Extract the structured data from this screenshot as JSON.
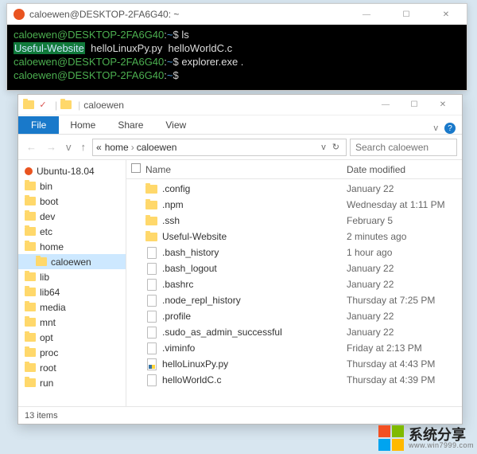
{
  "terminal": {
    "title": "caloewen@DESKTOP-2FA6G40: ~",
    "min": "—",
    "max": "☐",
    "close": "✕",
    "prompt_user": "caloewen@DESKTOP-2FA6G40",
    "prompt_sep": ":",
    "prompt_path": "~",
    "prompt_end": "$",
    "cmd1": "ls",
    "ls_highlight": "Useful-Website",
    "ls_item2": "helloLinuxPy.py",
    "ls_item3": "helloWorldC.c",
    "cmd2": "explorer.exe .",
    "cmd3": ""
  },
  "explorer": {
    "title": "caloewen",
    "min": "—",
    "max": "☐",
    "close": "✕",
    "tabs": {
      "file": "File",
      "home": "Home",
      "share": "Share",
      "view": "View"
    },
    "up_chev": "v",
    "help": "?",
    "nav": {
      "back": "←",
      "fwd": "→",
      "drop": "v",
      "up": "↑"
    },
    "addr": {
      "prefix": "«",
      "seg1": "home",
      "seg2": "caloewen",
      "go": "v",
      "refresh": "↻"
    },
    "search_placeholder": "Search caloewen",
    "cols": {
      "name": "Name",
      "date": "Date modified"
    },
    "tree_root": "Ubuntu-18.04",
    "tree": [
      {
        "label": "bin"
      },
      {
        "label": "boot"
      },
      {
        "label": "dev"
      },
      {
        "label": "etc"
      },
      {
        "label": "home",
        "expanded": true
      },
      {
        "label": "caloewen",
        "depth": 1,
        "selected": true
      },
      {
        "label": "lib"
      },
      {
        "label": "lib64"
      },
      {
        "label": "media"
      },
      {
        "label": "mnt"
      },
      {
        "label": "opt"
      },
      {
        "label": "proc"
      },
      {
        "label": "root"
      },
      {
        "label": "run"
      }
    ],
    "files": [
      {
        "name": ".config",
        "type": "folder",
        "date": "January 22"
      },
      {
        "name": ".npm",
        "type": "folder",
        "date": "Wednesday at 1:11 PM"
      },
      {
        "name": ".ssh",
        "type": "folder",
        "date": "February 5"
      },
      {
        "name": "Useful-Website",
        "type": "folder",
        "date": "2 minutes ago"
      },
      {
        "name": ".bash_history",
        "type": "file",
        "date": "1 hour ago"
      },
      {
        "name": ".bash_logout",
        "type": "file",
        "date": "January 22"
      },
      {
        "name": ".bashrc",
        "type": "file",
        "date": "January 22"
      },
      {
        "name": ".node_repl_history",
        "type": "file",
        "date": "Thursday at 7:25 PM"
      },
      {
        "name": ".profile",
        "type": "file",
        "date": "January 22"
      },
      {
        "name": ".sudo_as_admin_successful",
        "type": "file",
        "date": "January 22"
      },
      {
        "name": ".viminfo",
        "type": "file",
        "date": "Friday at 2:13 PM"
      },
      {
        "name": "helloLinuxPy.py",
        "type": "py",
        "date": "Thursday at 4:43 PM"
      },
      {
        "name": "helloWorldC.c",
        "type": "file",
        "date": "Thursday at 4:39 PM"
      }
    ],
    "status": "13 items"
  },
  "watermark": {
    "cn": "系统分享",
    "en": "www.win7999.com"
  }
}
